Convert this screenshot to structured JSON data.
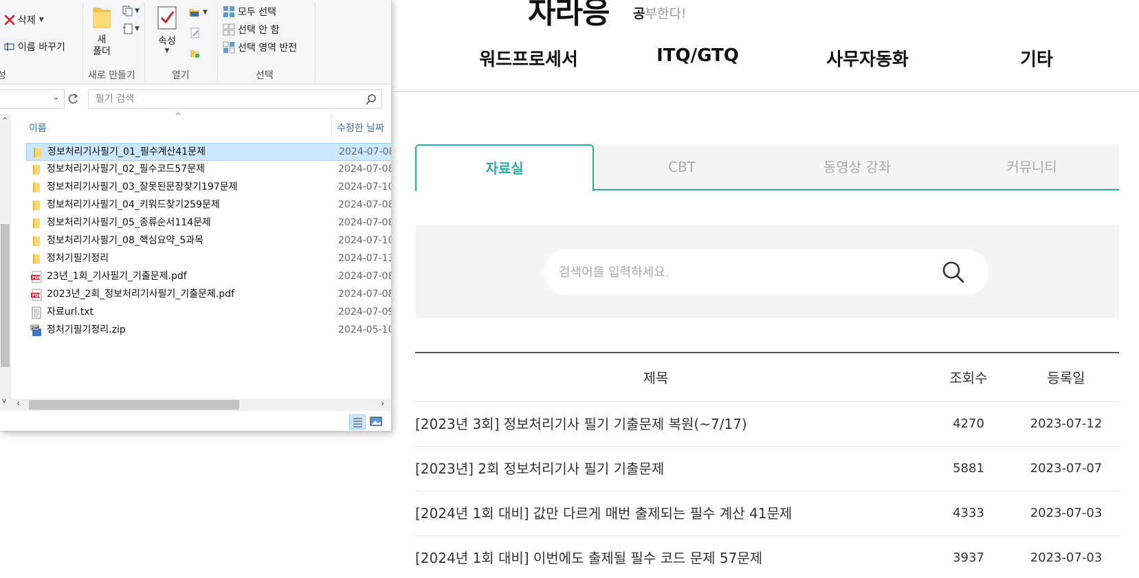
{
  "website": {
    "logo_text": "자라응",
    "slogan_strong": "공",
    "slogan_rest": "부한다!",
    "nav": [
      "워드프로세서",
      "ITQ/GTQ",
      "사무자동화",
      "기타"
    ],
    "tabs": [
      "자료실",
      "CBT",
      "동영상 강좌",
      "커뮤니티"
    ],
    "active_tab": "자료실",
    "search_placeholder": "검색어를 입력하세요.",
    "board_headers": {
      "title": "제목",
      "views": "조회수",
      "date": "등록일"
    },
    "posts": [
      {
        "title": "[2023년 3회] 정보처리기사 필기 기출문제 복원(~7/17)",
        "views": "4270",
        "date": "2023-07-12"
      },
      {
        "title": "[2023년] 2회 정보처리기사 필기 기출문제",
        "views": "5881",
        "date": "2023-07-07"
      },
      {
        "title": "[2024년 1회 대비] 값만 다르게 매번 출제되는 필수 계산 41문제",
        "views": "4333",
        "date": "2023-07-03"
      },
      {
        "title": "[2024년 1회 대비] 이번에도 출제될 필수 코드 문제 57문제",
        "views": "3937",
        "date": "2023-07-03"
      }
    ],
    "accent_color": "#21b1a4"
  },
  "explorer": {
    "ribbon": {
      "delete_label": "삭제",
      "rename_label": "이름 바꾸기",
      "org_group_label_partial": "성",
      "new_folder_label_line1": "새",
      "new_folder_label_line2": "폴더",
      "new_group_label": "새로 만들기",
      "properties_label": "속성",
      "open_group_label": "열기",
      "select_all_label": "모두 선택",
      "select_none_label": "선택 안 함",
      "invert_selection_label": "선택 영역 반전",
      "select_group_label": "선택"
    },
    "search_placeholder": "필기 검색",
    "columns": {
      "name": "이름",
      "modified": "수정한 날짜"
    },
    "files": [
      {
        "name": "정보처리기사필기_01_필수계산41문제",
        "date": "2024-07-08",
        "icon": "folder-icon",
        "selected": true
      },
      {
        "name": "정보처리기사필기_02_필수코드57문제",
        "date": "2024-07-08",
        "icon": "folder-icon"
      },
      {
        "name": "정보처리기사필기_03_잘못된문장찾기197문제",
        "date": "2024-07-10",
        "icon": "folder-icon"
      },
      {
        "name": "정보처리기사필기_04_키워드찾기259문제",
        "date": "2024-07-08",
        "icon": "folder-icon"
      },
      {
        "name": "정보처리기사필기_05_종류순서114문제",
        "date": "2024-07-08",
        "icon": "folder-icon"
      },
      {
        "name": "정보처리기사필기_08_핵심요약_5과목",
        "date": "2024-07-10",
        "icon": "folder-icon"
      },
      {
        "name": "정처기필기정리",
        "date": "2024-07-13",
        "icon": "folder-icon"
      },
      {
        "name": "23년_1회_기사필기_기출문제.pdf",
        "date": "2024-07-08",
        "icon": "pdf-icon"
      },
      {
        "name": "2023년_2회_정보처리기사필기_기출문제.pdf",
        "date": "2024-07-08",
        "icon": "pdf-icon"
      },
      {
        "name": "자료url.txt",
        "date": "2024-07-09",
        "icon": "text-file-icon"
      },
      {
        "name": "정처기필기정리.zip",
        "date": "2024-05-10",
        "icon": "zip-icon"
      }
    ]
  }
}
